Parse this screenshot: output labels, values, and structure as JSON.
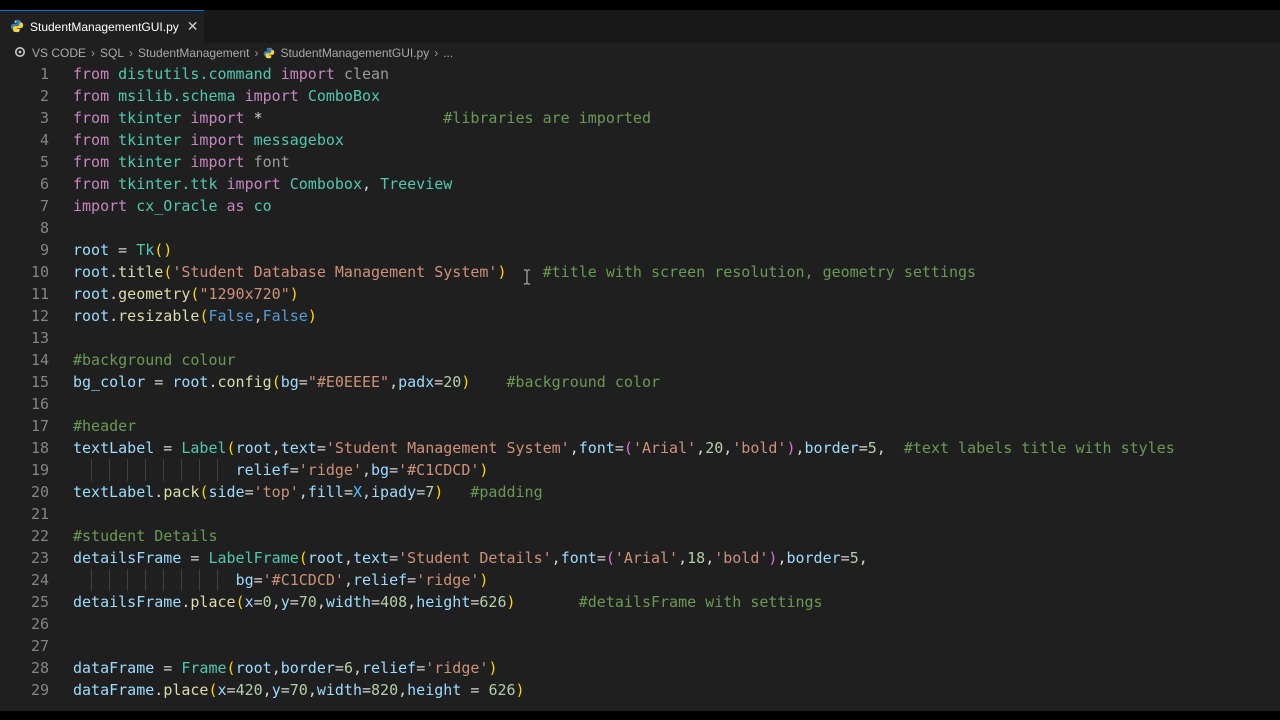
{
  "tab": {
    "filename": "StudentManagementGUI.py",
    "close_glyph": "✕"
  },
  "breadcrumb": {
    "items": [
      "VS CODE",
      "SQL",
      "StudentManagement",
      "StudentManagementGUI.py",
      "..."
    ],
    "separator": "›"
  },
  "icons": {
    "python": "python-icon",
    "close": "close-icon",
    "folder_circle": "outline-circle-icon"
  },
  "colors": {
    "keyword": "#c586c0",
    "module": "#4ec9b0",
    "function": "#dcdcaa",
    "variable": "#9cdcfe",
    "string": "#ce9178",
    "number": "#b5cea8",
    "comment": "#6a9955",
    "boolean": "#569cd6",
    "editor_bg": "#1f1f1f",
    "line_number": "#858585"
  },
  "lines": [
    {
      "n": "1",
      "tokens": [
        [
          "kw",
          "from"
        ],
        [
          "op",
          " "
        ],
        [
          "mod",
          "distutils.command"
        ],
        [
          "op",
          " "
        ],
        [
          "kw",
          "import"
        ],
        [
          "op",
          " "
        ],
        [
          "dim",
          "clean"
        ]
      ]
    },
    {
      "n": "2",
      "tokens": [
        [
          "kw",
          "from"
        ],
        [
          "op",
          " "
        ],
        [
          "mod",
          "msilib.schema"
        ],
        [
          "op",
          " "
        ],
        [
          "kw",
          "import"
        ],
        [
          "op",
          " "
        ],
        [
          "mod",
          "ComboBox"
        ]
      ]
    },
    {
      "n": "3",
      "tokens": [
        [
          "kw",
          "from"
        ],
        [
          "op",
          " "
        ],
        [
          "mod",
          "tkinter"
        ],
        [
          "op",
          " "
        ],
        [
          "kw",
          "import"
        ],
        [
          "op",
          " *                    "
        ],
        [
          "com",
          "#libraries are imported"
        ]
      ]
    },
    {
      "n": "4",
      "tokens": [
        [
          "kw",
          "from"
        ],
        [
          "op",
          " "
        ],
        [
          "mod",
          "tkinter"
        ],
        [
          "op",
          " "
        ],
        [
          "kw",
          "import"
        ],
        [
          "op",
          " "
        ],
        [
          "mod",
          "messagebox"
        ]
      ]
    },
    {
      "n": "5",
      "tokens": [
        [
          "kw",
          "from"
        ],
        [
          "op",
          " "
        ],
        [
          "mod",
          "tkinter"
        ],
        [
          "op",
          " "
        ],
        [
          "kw",
          "import"
        ],
        [
          "op",
          " "
        ],
        [
          "dim",
          "font"
        ]
      ]
    },
    {
      "n": "6",
      "tokens": [
        [
          "kw",
          "from"
        ],
        [
          "op",
          " "
        ],
        [
          "mod",
          "tkinter.ttk"
        ],
        [
          "op",
          " "
        ],
        [
          "kw",
          "import"
        ],
        [
          "op",
          " "
        ],
        [
          "mod",
          "Combobox"
        ],
        [
          "op",
          ", "
        ],
        [
          "mod",
          "Treeview"
        ]
      ]
    },
    {
      "n": "7",
      "tokens": [
        [
          "kw",
          "import"
        ],
        [
          "op",
          " "
        ],
        [
          "mod",
          "cx_Oracle"
        ],
        [
          "op",
          " "
        ],
        [
          "kw",
          "as"
        ],
        [
          "op",
          " "
        ],
        [
          "mod",
          "co"
        ]
      ]
    },
    {
      "n": "8",
      "tokens": []
    },
    {
      "n": "9",
      "tokens": [
        [
          "var",
          "root"
        ],
        [
          "op",
          " = "
        ],
        [
          "mod",
          "Tk"
        ],
        [
          "par",
          "()"
        ]
      ]
    },
    {
      "n": "10",
      "tokens": [
        [
          "var",
          "root"
        ],
        [
          "op",
          "."
        ],
        [
          "fn",
          "title"
        ],
        [
          "par",
          "("
        ],
        [
          "str",
          "'Student Database Management System'"
        ],
        [
          "par",
          ")"
        ],
        [
          "op",
          "    "
        ],
        [
          "com",
          "#title with screen resolution, geometry settings"
        ]
      ]
    },
    {
      "n": "11",
      "tokens": [
        [
          "var",
          "root"
        ],
        [
          "op",
          "."
        ],
        [
          "fn",
          "geometry"
        ],
        [
          "par",
          "("
        ],
        [
          "str",
          "\"1290x720\""
        ],
        [
          "par",
          ")"
        ]
      ]
    },
    {
      "n": "12",
      "tokens": [
        [
          "var",
          "root"
        ],
        [
          "op",
          "."
        ],
        [
          "fn",
          "resizable"
        ],
        [
          "par",
          "("
        ],
        [
          "bool",
          "False"
        ],
        [
          "op",
          ","
        ],
        [
          "bool",
          "False"
        ],
        [
          "par",
          ")"
        ]
      ]
    },
    {
      "n": "13",
      "tokens": []
    },
    {
      "n": "14",
      "tokens": [
        [
          "com",
          "#background colour"
        ]
      ]
    },
    {
      "n": "15",
      "tokens": [
        [
          "var",
          "bg_color"
        ],
        [
          "op",
          " = "
        ],
        [
          "var",
          "root"
        ],
        [
          "op",
          "."
        ],
        [
          "fn",
          "config"
        ],
        [
          "par",
          "("
        ],
        [
          "var",
          "bg"
        ],
        [
          "op",
          "="
        ],
        [
          "str",
          "\"#E0EEEE\""
        ],
        [
          "op",
          ","
        ],
        [
          "var",
          "padx"
        ],
        [
          "op",
          "="
        ],
        [
          "num",
          "20"
        ],
        [
          "par",
          ")"
        ],
        [
          "op",
          "    "
        ],
        [
          "com",
          "#background color"
        ]
      ]
    },
    {
      "n": "16",
      "tokens": []
    },
    {
      "n": "17",
      "tokens": [
        [
          "com",
          "#header"
        ]
      ]
    },
    {
      "n": "18",
      "tokens": [
        [
          "var",
          "textLabel"
        ],
        [
          "op",
          " = "
        ],
        [
          "mod",
          "Label"
        ],
        [
          "par",
          "("
        ],
        [
          "var",
          "root"
        ],
        [
          "op",
          ","
        ],
        [
          "var",
          "text"
        ],
        [
          "op",
          "="
        ],
        [
          "str",
          "'Student Management System'"
        ],
        [
          "op",
          ","
        ],
        [
          "var",
          "font"
        ],
        [
          "op",
          "="
        ],
        [
          "par2",
          "("
        ],
        [
          "str",
          "'Arial'"
        ],
        [
          "op",
          ","
        ],
        [
          "num",
          "20"
        ],
        [
          "op",
          ","
        ],
        [
          "str",
          "'bold'"
        ],
        [
          "par2",
          ")"
        ],
        [
          "op",
          ","
        ],
        [
          "var",
          "border"
        ],
        [
          "op",
          "="
        ],
        [
          "num",
          "5"
        ],
        [
          "op",
          ",  "
        ],
        [
          "com",
          "#text labels title with styles"
        ]
      ]
    },
    {
      "n": "19",
      "indent": true,
      "tokens": [
        [
          "op",
          "                  "
        ],
        [
          "var",
          "relief"
        ],
        [
          "op",
          "="
        ],
        [
          "str",
          "'ridge'"
        ],
        [
          "op",
          ","
        ],
        [
          "var",
          "bg"
        ],
        [
          "op",
          "="
        ],
        [
          "str",
          "'#C1CDCD'"
        ],
        [
          "par",
          ")"
        ]
      ]
    },
    {
      "n": "20",
      "tokens": [
        [
          "var",
          "textLabel"
        ],
        [
          "op",
          "."
        ],
        [
          "fn",
          "pack"
        ],
        [
          "par",
          "("
        ],
        [
          "var",
          "side"
        ],
        [
          "op",
          "="
        ],
        [
          "str",
          "'top'"
        ],
        [
          "op",
          ","
        ],
        [
          "var",
          "fill"
        ],
        [
          "op",
          "="
        ],
        [
          "const",
          "X"
        ],
        [
          "op",
          ","
        ],
        [
          "var",
          "ipady"
        ],
        [
          "op",
          "="
        ],
        [
          "num",
          "7"
        ],
        [
          "par",
          ")"
        ],
        [
          "op",
          "   "
        ],
        [
          "com",
          "#padding"
        ]
      ]
    },
    {
      "n": "21",
      "tokens": []
    },
    {
      "n": "22",
      "tokens": [
        [
          "com",
          "#student Details"
        ]
      ]
    },
    {
      "n": "23",
      "tokens": [
        [
          "var",
          "detailsFrame"
        ],
        [
          "op",
          " = "
        ],
        [
          "mod",
          "LabelFrame"
        ],
        [
          "par",
          "("
        ],
        [
          "var",
          "root"
        ],
        [
          "op",
          ","
        ],
        [
          "var",
          "text"
        ],
        [
          "op",
          "="
        ],
        [
          "str",
          "'Student Details'"
        ],
        [
          "op",
          ","
        ],
        [
          "var",
          "font"
        ],
        [
          "op",
          "="
        ],
        [
          "par2",
          "("
        ],
        [
          "str",
          "'Arial'"
        ],
        [
          "op",
          ","
        ],
        [
          "num",
          "18"
        ],
        [
          "op",
          ","
        ],
        [
          "str",
          "'bold'"
        ],
        [
          "par2",
          ")"
        ],
        [
          "op",
          ","
        ],
        [
          "var",
          "border"
        ],
        [
          "op",
          "="
        ],
        [
          "num",
          "5"
        ],
        [
          "op",
          ","
        ]
      ]
    },
    {
      "n": "24",
      "indent": true,
      "tokens": [
        [
          "op",
          "                  "
        ],
        [
          "var",
          "bg"
        ],
        [
          "op",
          "="
        ],
        [
          "str",
          "'#C1CDCD'"
        ],
        [
          "op",
          ","
        ],
        [
          "var",
          "relief"
        ],
        [
          "op",
          "="
        ],
        [
          "str",
          "'ridge'"
        ],
        [
          "par",
          ")"
        ]
      ]
    },
    {
      "n": "25",
      "tokens": [
        [
          "var",
          "detailsFrame"
        ],
        [
          "op",
          "."
        ],
        [
          "fn",
          "place"
        ],
        [
          "par",
          "("
        ],
        [
          "var",
          "x"
        ],
        [
          "op",
          "="
        ],
        [
          "num",
          "0"
        ],
        [
          "op",
          ","
        ],
        [
          "var",
          "y"
        ],
        [
          "op",
          "="
        ],
        [
          "num",
          "70"
        ],
        [
          "op",
          ","
        ],
        [
          "var",
          "width"
        ],
        [
          "op",
          "="
        ],
        [
          "num",
          "408"
        ],
        [
          "op",
          ","
        ],
        [
          "var",
          "height"
        ],
        [
          "op",
          "="
        ],
        [
          "num",
          "626"
        ],
        [
          "par",
          ")"
        ],
        [
          "op",
          "       "
        ],
        [
          "com",
          "#detailsFrame with settings"
        ]
      ]
    },
    {
      "n": "26",
      "tokens": []
    },
    {
      "n": "27",
      "tokens": []
    },
    {
      "n": "28",
      "tokens": [
        [
          "var",
          "dataFrame"
        ],
        [
          "op",
          " = "
        ],
        [
          "mod",
          "Frame"
        ],
        [
          "par",
          "("
        ],
        [
          "var",
          "root"
        ],
        [
          "op",
          ","
        ],
        [
          "var",
          "border"
        ],
        [
          "op",
          "="
        ],
        [
          "num",
          "6"
        ],
        [
          "op",
          ","
        ],
        [
          "var",
          "relief"
        ],
        [
          "op",
          "="
        ],
        [
          "str",
          "'ridge'"
        ],
        [
          "par",
          ")"
        ]
      ]
    },
    {
      "n": "29",
      "tokens": [
        [
          "var",
          "dataFrame"
        ],
        [
          "op",
          "."
        ],
        [
          "fn",
          "place"
        ],
        [
          "par",
          "("
        ],
        [
          "var",
          "x"
        ],
        [
          "op",
          "="
        ],
        [
          "num",
          "420"
        ],
        [
          "op",
          ","
        ],
        [
          "var",
          "y"
        ],
        [
          "op",
          "="
        ],
        [
          "num",
          "70"
        ],
        [
          "op",
          ","
        ],
        [
          "var",
          "width"
        ],
        [
          "op",
          "="
        ],
        [
          "num",
          "820"
        ],
        [
          "op",
          ","
        ],
        [
          "var",
          "height"
        ],
        [
          "op",
          " = "
        ],
        [
          "num",
          "626"
        ],
        [
          "par",
          ")"
        ]
      ]
    }
  ]
}
